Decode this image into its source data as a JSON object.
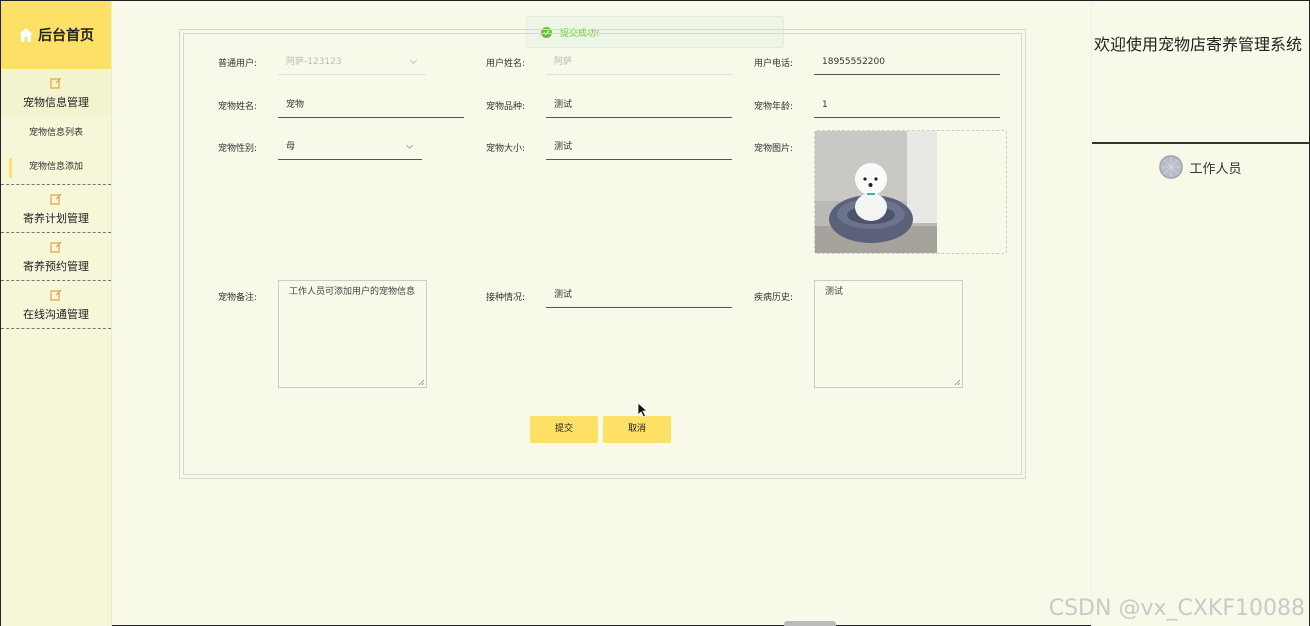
{
  "sidebar": {
    "home_label": "后台首页",
    "groups": [
      {
        "label": "宠物信息管理",
        "icon": "edit-icon"
      },
      {
        "label": "寄养计划管理",
        "icon": "edit-icon"
      },
      {
        "label": "寄养预约管理",
        "icon": "edit-icon"
      },
      {
        "label": "在线沟通管理",
        "icon": "edit-icon"
      }
    ],
    "sub_items": [
      "宠物信息列表",
      "宠物信息添加"
    ],
    "selected_sub_item": "宠物信息添加"
  },
  "header_right": {
    "system_title": "欢迎使用宠物店寄养管理系统",
    "role": "工作人员"
  },
  "toast": {
    "message": "提交成功!",
    "type": "success"
  },
  "form": {
    "fields": {
      "user": {
        "label": "普通用户:",
        "value": "阿萨-123123",
        "disabled": true
      },
      "user_name": {
        "label": "用户姓名:",
        "value": "阿萨",
        "disabled": true
      },
      "user_phone": {
        "label": "用户电话:",
        "value": "18955552200"
      },
      "pet_name": {
        "label": "宠物姓名:",
        "value": "宠物"
      },
      "pet_breed": {
        "label": "宠物品种:",
        "value": "测试"
      },
      "pet_age": {
        "label": "宠物年龄:",
        "value": "1"
      },
      "pet_gender": {
        "label": "宠物性别:",
        "value": "母"
      },
      "pet_size": {
        "label": "宠物大小:",
        "value": "测试"
      },
      "pet_image": {
        "label": "宠物图片:"
      },
      "pet_remark": {
        "label": "宠物备注:",
        "value": "工作人员可添加用户的宠物信息"
      },
      "vaccination": {
        "label": "接种情况:",
        "value": "测试"
      },
      "disease_history": {
        "label": "疾病历史:",
        "value": "测试"
      }
    },
    "submit_label": "提交",
    "cancel_label": "取消"
  },
  "watermark": "CSDN @vx_CXKF10088",
  "colors": {
    "accent": "#fde066",
    "background": "#f9f9e9",
    "success": "#67c23a"
  }
}
